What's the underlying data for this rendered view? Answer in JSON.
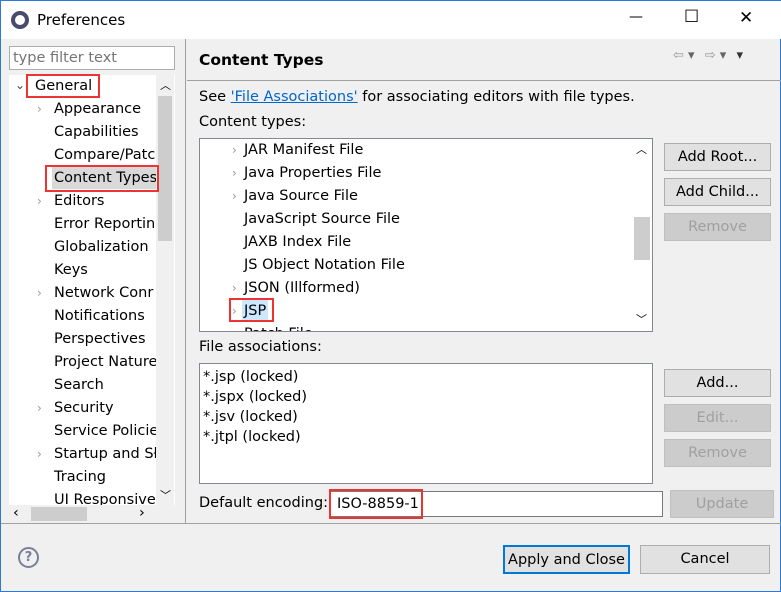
{
  "window": {
    "title": "Preferences",
    "minimize": "—",
    "maximize": "☐",
    "close": "✕"
  },
  "sidebar": {
    "filter_placeholder": "type filter text",
    "items": [
      {
        "label": "General",
        "expanded": true,
        "level": 0
      },
      {
        "label": "Appearance",
        "has_children": true
      },
      {
        "label": "Capabilities"
      },
      {
        "label": "Compare/Patc"
      },
      {
        "label": "Content Types",
        "selected": true
      },
      {
        "label": "Editors",
        "has_children": true
      },
      {
        "label": "Error Reportin"
      },
      {
        "label": "Globalization"
      },
      {
        "label": "Keys"
      },
      {
        "label": "Network Conr",
        "has_children": true
      },
      {
        "label": "Notifications"
      },
      {
        "label": "Perspectives"
      },
      {
        "label": "Project Nature"
      },
      {
        "label": "Search"
      },
      {
        "label": "Security",
        "has_children": true
      },
      {
        "label": "Service Policie"
      },
      {
        "label": "Startup and Sł",
        "has_children": true
      },
      {
        "label": "Tracing"
      },
      {
        "label": "UI Responsive"
      }
    ]
  },
  "page": {
    "title": "Content Types",
    "see_prefix": "See ",
    "link": "'File Associations'",
    "see_suffix": " for associating editors with file types.",
    "content_types_label": "Content types:",
    "content_types": [
      {
        "label": "JAR Manifest File",
        "has_children": true
      },
      {
        "label": "Java Properties File",
        "has_children": true
      },
      {
        "label": "Java Source File",
        "has_children": true
      },
      {
        "label": "JavaScript Source File"
      },
      {
        "label": "JAXB Index File"
      },
      {
        "label": "JS Object Notation File"
      },
      {
        "label": "JSON (Illformed)",
        "has_children": true
      },
      {
        "label": "JSP",
        "selected": true,
        "has_children": true
      },
      {
        "label": "Patch File"
      }
    ],
    "add_root": "Add Root...",
    "add_child": "Add Child...",
    "remove": "Remove",
    "file_assoc_label": "File associations:",
    "file_assocs": [
      "*.jsp (locked)",
      "*.jspx (locked)",
      "*.jsv (locked)",
      "*.jtpl (locked)"
    ],
    "add": "Add...",
    "edit": "Edit...",
    "remove2": "Remove",
    "encoding_label": "Default encoding:",
    "encoding_value": "ISO-8859-1",
    "update": "Update"
  },
  "footer": {
    "apply_close": "Apply and Close",
    "cancel": "Cancel"
  },
  "colors": {
    "highlight": "#e33333",
    "link": "#0066cc",
    "selection": "#cce8ff"
  }
}
